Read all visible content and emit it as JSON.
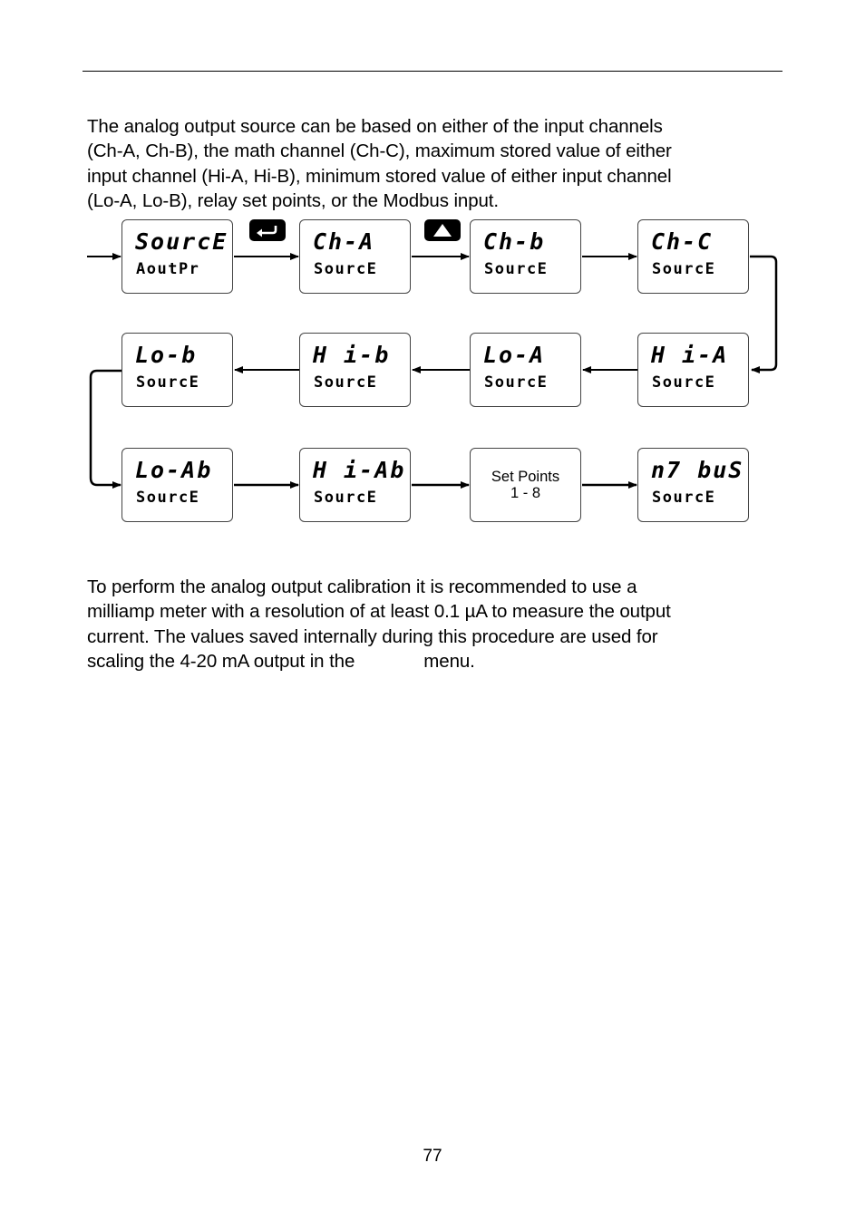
{
  "intro_paragraph": "The analog output source can be based on either of the input channels (Ch-A, Ch-B), the math channel (Ch-C), maximum stored value of either input channel (Hi-A, Hi-B), minimum stored value of either input channel (Lo-A, Lo-B), relay set points, or the Modbus input.",
  "intro_lines": [
    "The analog output source can be based on either of the input channels",
    "(Ch-A, Ch-B), the math channel (Ch-C), maximum stored value of either",
    "input channel (Hi-A, Hi-B), minimum stored value of either input channel",
    "(Lo-A, Lo-B), relay set points, or the Modbus input."
  ],
  "diagram": {
    "keys": {
      "enter": {
        "icon": "enter-key-icon",
        "glyph": "↵"
      },
      "up": {
        "icon": "up-key-icon",
        "glyph": "▲"
      }
    },
    "boxes": [
      {
        "id": "source-aoutpr",
        "line1": "SourcE",
        "line2": "AoutPr"
      },
      {
        "id": "ch-a",
        "line1": "Ch-A",
        "line2": "SourcE"
      },
      {
        "id": "ch-b",
        "line1": "Ch-b",
        "line2": "SourcE"
      },
      {
        "id": "ch-c",
        "line1": "Ch-C",
        "line2": "SourcE"
      },
      {
        "id": "hi-a",
        "line1": "H i-A",
        "line2": "SourcE"
      },
      {
        "id": "lo-a",
        "line1": "Lo-A",
        "line2": "SourcE"
      },
      {
        "id": "hi-b",
        "line1": "H i-b",
        "line2": "SourcE"
      },
      {
        "id": "lo-b",
        "line1": "Lo-b",
        "line2": "SourcE"
      },
      {
        "id": "lo-ab",
        "line1": "Lo-Ab",
        "line2": "SourcE"
      },
      {
        "id": "hi-ab",
        "line1": "H i-Ab",
        "line2": "SourcE"
      },
      {
        "id": "set-points",
        "line1": "Set Points",
        "line2": "1 - 8"
      },
      {
        "id": "modbus",
        "line1": "n7 buS",
        "line2": "SourcE"
      }
    ]
  },
  "calibration_lines": [
    "To perform the analog output calibration it is recommended to use a",
    "milliamp meter with a resolution of at least 0.1 µA to measure the output",
    "current. The values saved internally during this procedure are used for",
    "scaling the 4-20 mA output in the"
  ],
  "calibration_tail": "menu.",
  "page_number": "77"
}
